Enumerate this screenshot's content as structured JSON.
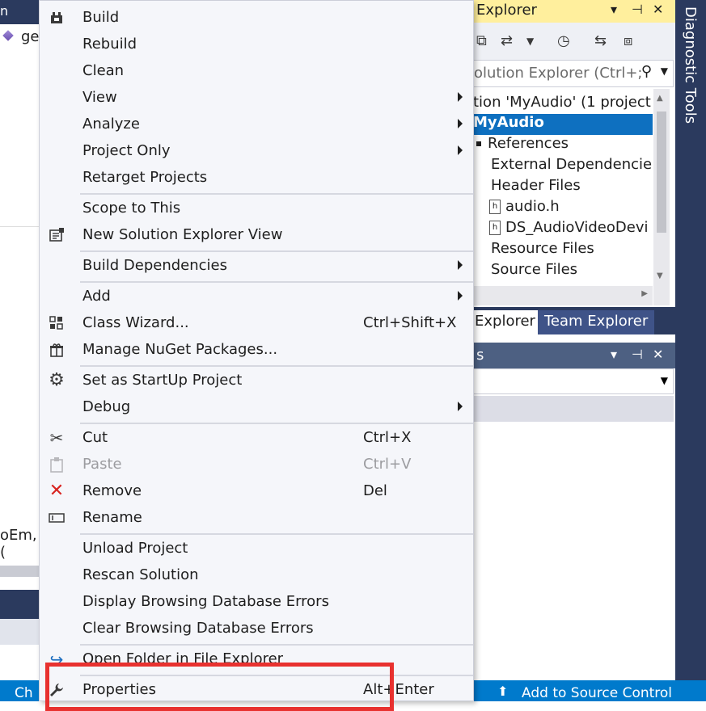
{
  "left_panel": {
    "tab_strip_text": "n",
    "editor_tab": "ge",
    "code_fragment": "oEm, (",
    "statusbar_text": "Ch"
  },
  "solution_explorer": {
    "title": "Explorer",
    "title_controls": [
      "▾",
      "⊣",
      "✕"
    ],
    "search_placeholder": "olution Explorer (Ctrl+;",
    "tree": [
      {
        "label": "tion 'MyAudio' (1 project",
        "selected": false
      },
      {
        "label": "MyAudio",
        "selected": true
      },
      {
        "label": "References",
        "selected": false
      },
      {
        "label": "External Dependencies",
        "selected": false
      },
      {
        "label": "Header Files",
        "selected": false
      },
      {
        "label": "audio.h",
        "selected": false
      },
      {
        "label": "DS_AudioVideoDevi",
        "selected": false
      },
      {
        "label": "Resource Files",
        "selected": false
      },
      {
        "label": "Source Files",
        "selected": false
      }
    ],
    "tabs": [
      "Explorer",
      "Team Explorer"
    ]
  },
  "properties_panel": {
    "title": "s",
    "title_controls": [
      "▾",
      "⊣",
      "✕"
    ]
  },
  "right_strip": {
    "label": "Diagnostic Tools"
  },
  "status_bar": {
    "source_control": "Add to Source Control"
  },
  "context_menu": {
    "items": [
      {
        "label": "Build",
        "shortcut": "",
        "submenu": false,
        "icon": "build-icon",
        "disabled": false
      },
      {
        "label": "Rebuild",
        "shortcut": "",
        "submenu": false,
        "icon": "",
        "disabled": false
      },
      {
        "label": "Clean",
        "shortcut": "",
        "submenu": false,
        "icon": "",
        "disabled": false
      },
      {
        "label": "View",
        "shortcut": "",
        "submenu": true,
        "icon": "",
        "disabled": false
      },
      {
        "label": "Analyze",
        "shortcut": "",
        "submenu": true,
        "icon": "",
        "disabled": false
      },
      {
        "label": "Project Only",
        "shortcut": "",
        "submenu": true,
        "icon": "",
        "disabled": false
      },
      {
        "label": "Retarget Projects",
        "shortcut": "",
        "submenu": false,
        "icon": "",
        "disabled": false
      },
      {
        "label": "Scope to This",
        "shortcut": "",
        "submenu": false,
        "icon": "",
        "disabled": false
      },
      {
        "label": "New Solution Explorer View",
        "shortcut": "",
        "submenu": false,
        "icon": "new-view-icon",
        "disabled": false
      },
      {
        "label": "Build Dependencies",
        "shortcut": "",
        "submenu": true,
        "icon": "",
        "disabled": false
      },
      {
        "label": "Add",
        "shortcut": "",
        "submenu": true,
        "icon": "",
        "disabled": false
      },
      {
        "label": "Class Wizard...",
        "shortcut": "Ctrl+Shift+X",
        "submenu": false,
        "icon": "class-wizard-icon",
        "disabled": false
      },
      {
        "label": "Manage NuGet Packages...",
        "shortcut": "",
        "submenu": false,
        "icon": "nuget-icon",
        "disabled": false
      },
      {
        "label": "Set as StartUp Project",
        "shortcut": "",
        "submenu": false,
        "icon": "gear-icon",
        "disabled": false
      },
      {
        "label": "Debug",
        "shortcut": "",
        "submenu": true,
        "icon": "",
        "disabled": false
      },
      {
        "label": "Cut",
        "shortcut": "Ctrl+X",
        "submenu": false,
        "icon": "scissors-icon",
        "disabled": false
      },
      {
        "label": "Paste",
        "shortcut": "Ctrl+V",
        "submenu": false,
        "icon": "paste-icon",
        "disabled": true
      },
      {
        "label": "Remove",
        "shortcut": "Del",
        "submenu": false,
        "icon": "remove-icon",
        "disabled": false
      },
      {
        "label": "Rename",
        "shortcut": "",
        "submenu": false,
        "icon": "rename-icon",
        "disabled": false
      },
      {
        "label": "Unload Project",
        "shortcut": "",
        "submenu": false,
        "icon": "",
        "disabled": false
      },
      {
        "label": "Rescan Solution",
        "shortcut": "",
        "submenu": false,
        "icon": "",
        "disabled": false
      },
      {
        "label": "Display Browsing Database Errors",
        "shortcut": "",
        "submenu": false,
        "icon": "",
        "disabled": false
      },
      {
        "label": "Clear Browsing Database Errors",
        "shortcut": "",
        "submenu": false,
        "icon": "",
        "disabled": false
      },
      {
        "label": "Open Folder in File Explorer",
        "shortcut": "",
        "submenu": false,
        "icon": "open-folder-icon",
        "disabled": false
      },
      {
        "label": "Properties",
        "shortcut": "Alt+Enter",
        "submenu": false,
        "icon": "wrench-icon",
        "disabled": false
      }
    ]
  },
  "colors": {
    "accent_blue": "#007acc",
    "selection_blue": "#0e70c0",
    "highlight_red": "#e8312f",
    "remove_red": "#d8231f",
    "title_yellow": "#ffef9d",
    "dark_navy": "#2b3a5e"
  }
}
